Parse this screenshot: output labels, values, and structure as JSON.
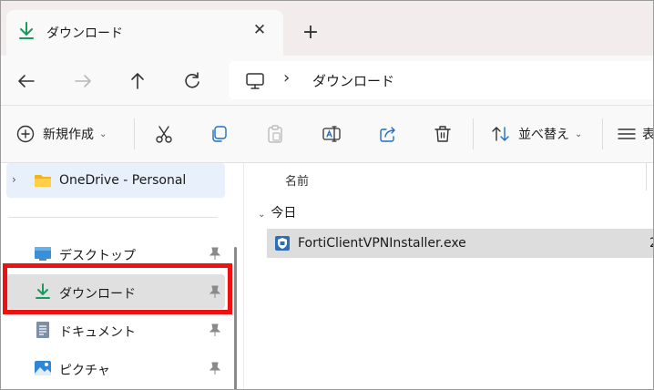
{
  "tab": {
    "title": "ダウンロード",
    "icon": "download-icon",
    "close_icon": "close-icon"
  },
  "new_tab_icon": "plus-icon",
  "nav": {
    "back_icon": "arrow-left-icon",
    "forward_icon": "arrow-right-icon",
    "up_icon": "arrow-up-icon",
    "refresh_icon": "refresh-icon"
  },
  "address": {
    "location_icon": "monitor-icon",
    "separator": "›",
    "crumb": "ダウンロード"
  },
  "commands": {
    "new_label": "新規作成",
    "new_chevron": "⌄",
    "sort_label": "並べ替え",
    "sort_chevron": "⌄",
    "view_label": "表",
    "icons": [
      "plus-circle-icon",
      "cut-icon",
      "copy-icon",
      "paste-icon",
      "rename-icon",
      "share-icon",
      "delete-icon",
      "sort-icon",
      "view-icon"
    ]
  },
  "sidebar": {
    "items": [
      {
        "label": "OneDrive - Personal",
        "icon": "folder-icon",
        "expand": "›"
      },
      {
        "label": "デスクトップ",
        "icon": "desktop-icon",
        "pinned": true
      },
      {
        "label": "ダウンロード",
        "icon": "download-icon",
        "pinned": true,
        "selected": true
      },
      {
        "label": "ドキュメント",
        "icon": "document-icon",
        "pinned": true
      },
      {
        "label": "ピクチャ",
        "icon": "pictures-icon",
        "pinned": true
      }
    ]
  },
  "file_list": {
    "column_name": "名前",
    "group_label": "今日",
    "group_chevron": "⌄",
    "files": [
      {
        "name": "FortiClientVPNInstaller.exe",
        "icon": "installer-icon",
        "trailing": "2"
      }
    ]
  },
  "colors": {
    "highlight_box": "#ee1111",
    "accent_green": "#1a9a5c",
    "selected_row": "#dddddd"
  }
}
